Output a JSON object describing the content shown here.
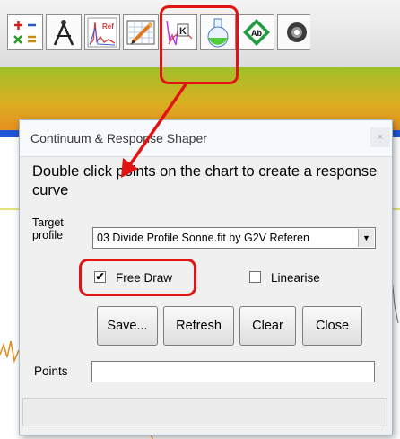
{
  "toolbar": {
    "icons": [
      {
        "name": "math-operators-icon"
      },
      {
        "name": "compass-icon"
      },
      {
        "name": "reference-spectrum-icon",
        "label": "Ref"
      },
      {
        "name": "response-shaper-icon"
      },
      {
        "name": "line-identify-icon",
        "label": "K"
      },
      {
        "name": "flask-icon"
      },
      {
        "name": "label-tag-icon",
        "label": "Ab"
      },
      {
        "name": "settings-icon"
      }
    ]
  },
  "dialog": {
    "title": "Continuum & Response Shaper",
    "close_glyph": "×",
    "instruction": "Double click points on the chart to create a response curve",
    "target_label": "Target profile",
    "target_value": "03 Divide Profile Sonne.fit by G2V Referen",
    "free_draw": {
      "label": "Free Draw",
      "checked": true,
      "glyph": "✔"
    },
    "linearise": {
      "label": "Linearise",
      "checked": false
    },
    "buttons": {
      "save": "Save...",
      "refresh": "Refresh",
      "clear": "Clear",
      "close": "Close"
    },
    "points_label": "Points",
    "points_value": ""
  },
  "colors": {
    "highlight": "#e11414",
    "title_bar": "#f7f9fc",
    "dialog_bg": "#f0f0f0",
    "chart_green": "#9fc02a",
    "chart_orange": "#e88f20",
    "chart_blue": "#1f55d6"
  }
}
